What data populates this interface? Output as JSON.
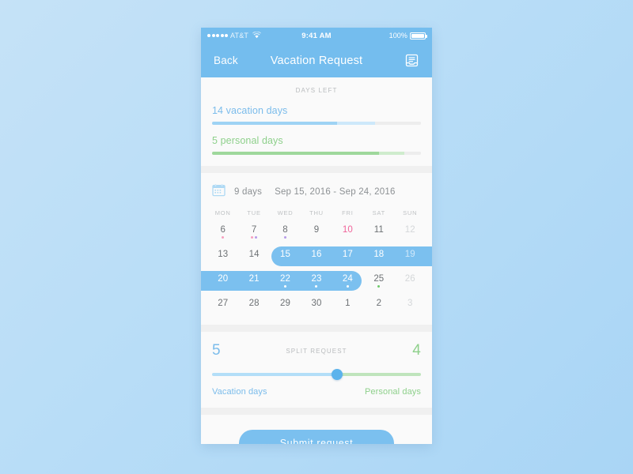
{
  "status_bar": {
    "signal_dots": 5,
    "carrier": "AT&T",
    "wifi_icon": "wifi-icon",
    "time": "9:41 AM",
    "battery_percent": "100%"
  },
  "nav": {
    "back_label": "Back",
    "title": "Vacation Request",
    "action_icon": "archive-tray-icon"
  },
  "days_left": {
    "section_label": "DAYS LEFT",
    "meters": [
      {
        "label": "14 vacation days",
        "color": "#7bbceb",
        "segments": [
          {
            "pct": 60,
            "color": "#9ed3f4"
          },
          {
            "pct": 18,
            "color": "#cde8fa"
          },
          {
            "pct": 22,
            "color": "#ededed"
          }
        ]
      },
      {
        "label": "5 personal days",
        "color": "#8ed08b",
        "segments": [
          {
            "pct": 80,
            "color": "#9fd89c"
          },
          {
            "pct": 12,
            "color": "#cfeccd"
          },
          {
            "pct": 8,
            "color": "#ededed"
          }
        ]
      }
    ]
  },
  "date_range": {
    "icon": "calendar-icon",
    "days_count": "9 days",
    "range": "Sep 15, 2016 - Sep 24, 2016"
  },
  "calendar": {
    "weekday_headers": [
      "MON",
      "TUE",
      "WED",
      "THU",
      "FRI",
      "SAT",
      "SUN"
    ],
    "rows": [
      {
        "selection": null,
        "cells": [
          {
            "day": "6",
            "state": "normal",
            "dots": [
              "#f6a0bf"
            ]
          },
          {
            "day": "7",
            "state": "normal",
            "dots": [
              "#f6a0bf",
              "#b79ae8"
            ]
          },
          {
            "day": "8",
            "state": "normal",
            "dots": [
              "#b79ae8"
            ]
          },
          {
            "day": "9",
            "state": "normal",
            "dots": []
          },
          {
            "day": "10",
            "state": "today",
            "dots": []
          },
          {
            "day": "11",
            "state": "normal",
            "dots": []
          },
          {
            "day": "12",
            "state": "muted",
            "dots": []
          }
        ]
      },
      {
        "selection": {
          "start_index": 2,
          "end_index": 6,
          "cap_left": true,
          "cap_right": false
        },
        "cells": [
          {
            "day": "13",
            "state": "normal",
            "dots": []
          },
          {
            "day": "14",
            "state": "normal",
            "dots": []
          },
          {
            "day": "15",
            "state": "selected",
            "dots": []
          },
          {
            "day": "16",
            "state": "selected",
            "dots": []
          },
          {
            "day": "17",
            "state": "selected",
            "dots": []
          },
          {
            "day": "18",
            "state": "selected",
            "dots": []
          },
          {
            "day": "19",
            "state": "selected-muted",
            "dots": []
          }
        ]
      },
      {
        "selection": {
          "start_index": 0,
          "end_index": 4,
          "cap_left": false,
          "cap_right": true
        },
        "cells": [
          {
            "day": "20",
            "state": "selected",
            "dots": []
          },
          {
            "day": "21",
            "state": "selected",
            "dots": []
          },
          {
            "day": "22",
            "state": "selected",
            "dots": [
              "#ffffff"
            ]
          },
          {
            "day": "23",
            "state": "selected",
            "dots": [
              "#ffffff"
            ]
          },
          {
            "day": "24",
            "state": "selected",
            "dots": [
              "#ffffff"
            ]
          },
          {
            "day": "25",
            "state": "normal",
            "dots": [
              "#6fc96b"
            ]
          },
          {
            "day": "26",
            "state": "muted",
            "dots": []
          }
        ]
      },
      {
        "selection": null,
        "cells": [
          {
            "day": "27",
            "state": "normal",
            "dots": []
          },
          {
            "day": "28",
            "state": "normal",
            "dots": []
          },
          {
            "day": "29",
            "state": "normal",
            "dots": []
          },
          {
            "day": "30",
            "state": "normal",
            "dots": []
          },
          {
            "day": "1",
            "state": "normal",
            "dots": []
          },
          {
            "day": "2",
            "state": "normal",
            "dots": []
          },
          {
            "day": "3",
            "state": "muted",
            "dots": []
          }
        ]
      }
    ]
  },
  "split_request": {
    "title": "SPLIT REQUEST",
    "left_value": "5",
    "right_value": "4",
    "left_label": "Vacation days",
    "right_label": "Personal days",
    "thumb_percent": 60,
    "left_track_color": "#b3def8",
    "right_track_color": "#bfe4bc",
    "thumb_color": "#5cb3ec"
  },
  "submit": {
    "label": "Submit  request",
    "color": "#7bc0ef"
  }
}
